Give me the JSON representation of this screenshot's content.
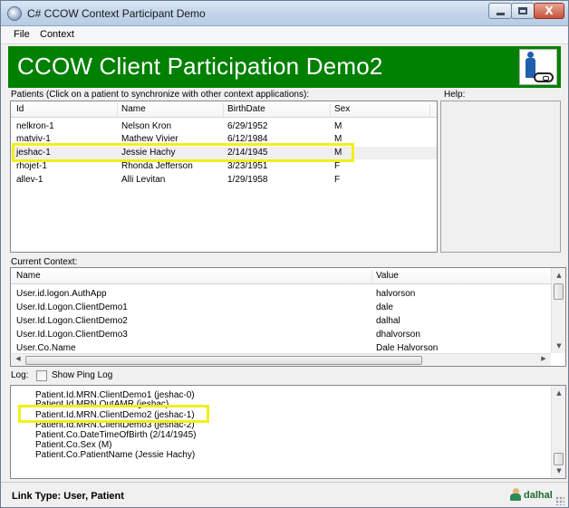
{
  "window": {
    "title": "C# CCOW Context Participant Demo",
    "close_glyph": "X"
  },
  "menu": {
    "file": "File",
    "context": "Context"
  },
  "banner": {
    "title": "CCOW Client Participation Demo2",
    "background": "#008000"
  },
  "patients": {
    "label": "Patients (Click on a patient to synchronize with other context applications):",
    "columns": [
      "Id",
      "Name",
      "BirthDate",
      "Sex"
    ],
    "rows": [
      {
        "id": "nelkron-1",
        "name": "Nelson Kron",
        "birthdate": "6/29/1952",
        "sex": "M"
      },
      {
        "id": "matviv-1",
        "name": "Mathew Vivier",
        "birthdate": "6/12/1984",
        "sex": "M"
      },
      {
        "id": "jeshac-1",
        "name": "Jessie Hachy",
        "birthdate": "2/14/1945",
        "sex": "M"
      },
      {
        "id": "rhojet-1",
        "name": "Rhonda Jefferson",
        "birthdate": "3/23/1951",
        "sex": "F"
      },
      {
        "id": "allev-1",
        "name": "Alli Levitan",
        "birthdate": "1/29/1958",
        "sex": "F"
      }
    ],
    "selected_index": 2
  },
  "help": {
    "label": "Help:"
  },
  "context": {
    "label": "Current Context:",
    "columns": [
      "Name",
      "Value"
    ],
    "rows": [
      {
        "name": "User.id.logon.AuthApp",
        "value": "halvorson"
      },
      {
        "name": "User.Id.Logon.ClientDemo1",
        "value": "dale"
      },
      {
        "name": "User.Id.Logon.ClientDemo2",
        "value": "dalhal"
      },
      {
        "name": "User.Id.Logon.ClientDemo3",
        "value": "dhalvorson"
      },
      {
        "name": "User.Co.Name",
        "value": "Dale Halvorson"
      }
    ]
  },
  "log": {
    "label": "Log:",
    "checkbox_label": "Show Ping Log",
    "show_ping_checked": false,
    "lines": [
      "Patient.Id.MRN.ClientDemo1 (jeshac-0)",
      "Patient.Id.MRN.OutAMR (jeshac)",
      "Patient.Id.MRN.ClientDemo2 (jeshac-1)",
      "Patient.Id.MRN.ClientDemo3 (jeshac-2)",
      "Patient.Co.DateTimeOfBirth (2/14/1945)",
      "Patient.Co.Sex (M)",
      "Patient.Co.PatientName (Jessie Hachy)"
    ]
  },
  "status": {
    "link_type": "Link Type: User, Patient",
    "user": "dalhal"
  },
  "colors": {
    "highlight": "#f2ef1a",
    "banner_green": "#008000",
    "status_user_green": "#1e6b2f"
  }
}
